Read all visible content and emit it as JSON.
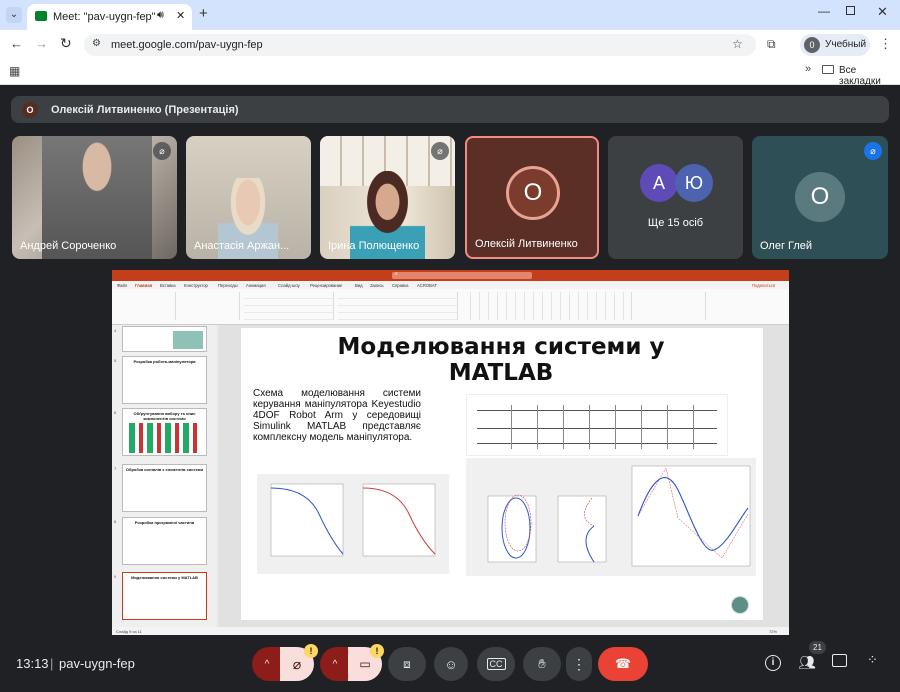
{
  "browser": {
    "tab_title": "Meet: \"pav-uygn-fep\"",
    "url": "meet.google.com/pav-uygn-fep",
    "profile_label": "Учебный",
    "profile_initial": "0",
    "bookmarks_label": "Все закладки"
  },
  "meet": {
    "presenter_initial": "О",
    "presenter_bar": "Олексій Литвиненко (Презентація)",
    "participants": [
      {
        "name": "Андрей Сороченко",
        "muted": true
      },
      {
        "name": "Анастасія Аржан...",
        "muted": false
      },
      {
        "name": "Ірина Полющенко",
        "muted": true
      },
      {
        "name": "Олексій Литвиненко",
        "initial": "О",
        "muted": false
      },
      {
        "name": "Ще 15 осіб",
        "initials": [
          "А",
          "Ю"
        ]
      },
      {
        "name": "Олег Глей",
        "initial": "О",
        "muted": true
      }
    ],
    "time": "13:13",
    "meeting_code": "pav-uygn-fep",
    "participant_count": "21",
    "warn_mark": "!"
  },
  "ppt": {
    "tabs": [
      "Файл",
      "Главная",
      "Вставка",
      "Конструктор",
      "Переходы",
      "Анимация",
      "Слайд-шоу",
      "Рецензирование",
      "Вид",
      "Запись",
      "Справка",
      "ACROBAT"
    ],
    "search_placeholder": "Поиск",
    "share_label": "Поделиться",
    "slide_title": "Моделювання системи у MATLAB",
    "slide_body": "Схема моделювання системи керування маніпулятора Keyestudio 4DOF Robot Arm у середовищі Simulink MATLAB представляє комплексну модель маніпулятора.",
    "thumbs": [
      "",
      "Розробка робота-маніпулятора",
      "Обґрунтування вибору та опис компонентів системи",
      "Обробка сигналів з елементів системи",
      "Розробка програмної частини",
      "Моделювання системи у MATLAB"
    ],
    "thumb_numbers": [
      "4",
      "5",
      "6",
      "7",
      "8",
      "9"
    ],
    "status_left": "Слайд 9 из 11",
    "status_zoom": "72%"
  }
}
